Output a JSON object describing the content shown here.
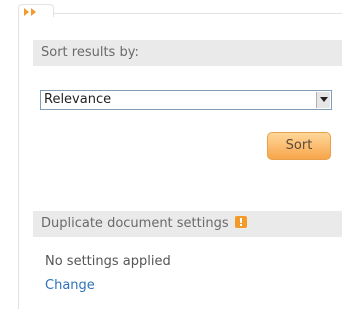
{
  "tab": {
    "icon": "expand-arrows-icon"
  },
  "sort": {
    "header": "Sort results by:",
    "selected": "Relevance",
    "button_label": "Sort"
  },
  "duplicates": {
    "header": "Duplicate document settings",
    "info_icon": "info-icon",
    "status": "No settings applied",
    "link_label": "Change"
  },
  "colors": {
    "accent": "#f7a54a",
    "header_bg": "#eaeaea",
    "link": "#2e72b8",
    "tab_arrows": "#f39a2a"
  }
}
